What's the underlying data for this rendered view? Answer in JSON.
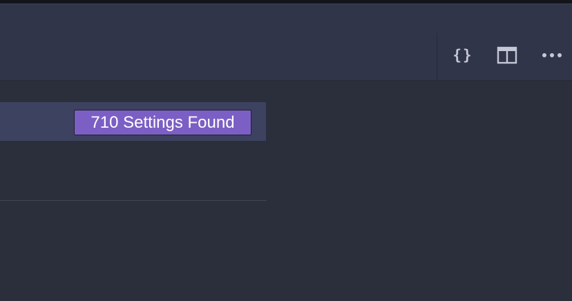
{
  "editor_actions": {
    "open_json_icon": "braces-icon",
    "split_editor_icon": "split-editor-icon",
    "more_actions_icon": "ellipsis-icon"
  },
  "search": {
    "result_count": "710 Settings Found"
  },
  "colors": {
    "background": "#2b2e3b",
    "tab_bar": "#313549",
    "search_row": "#3d4260",
    "badge": "#7c5fc4",
    "icon": "#c5c8d6"
  }
}
